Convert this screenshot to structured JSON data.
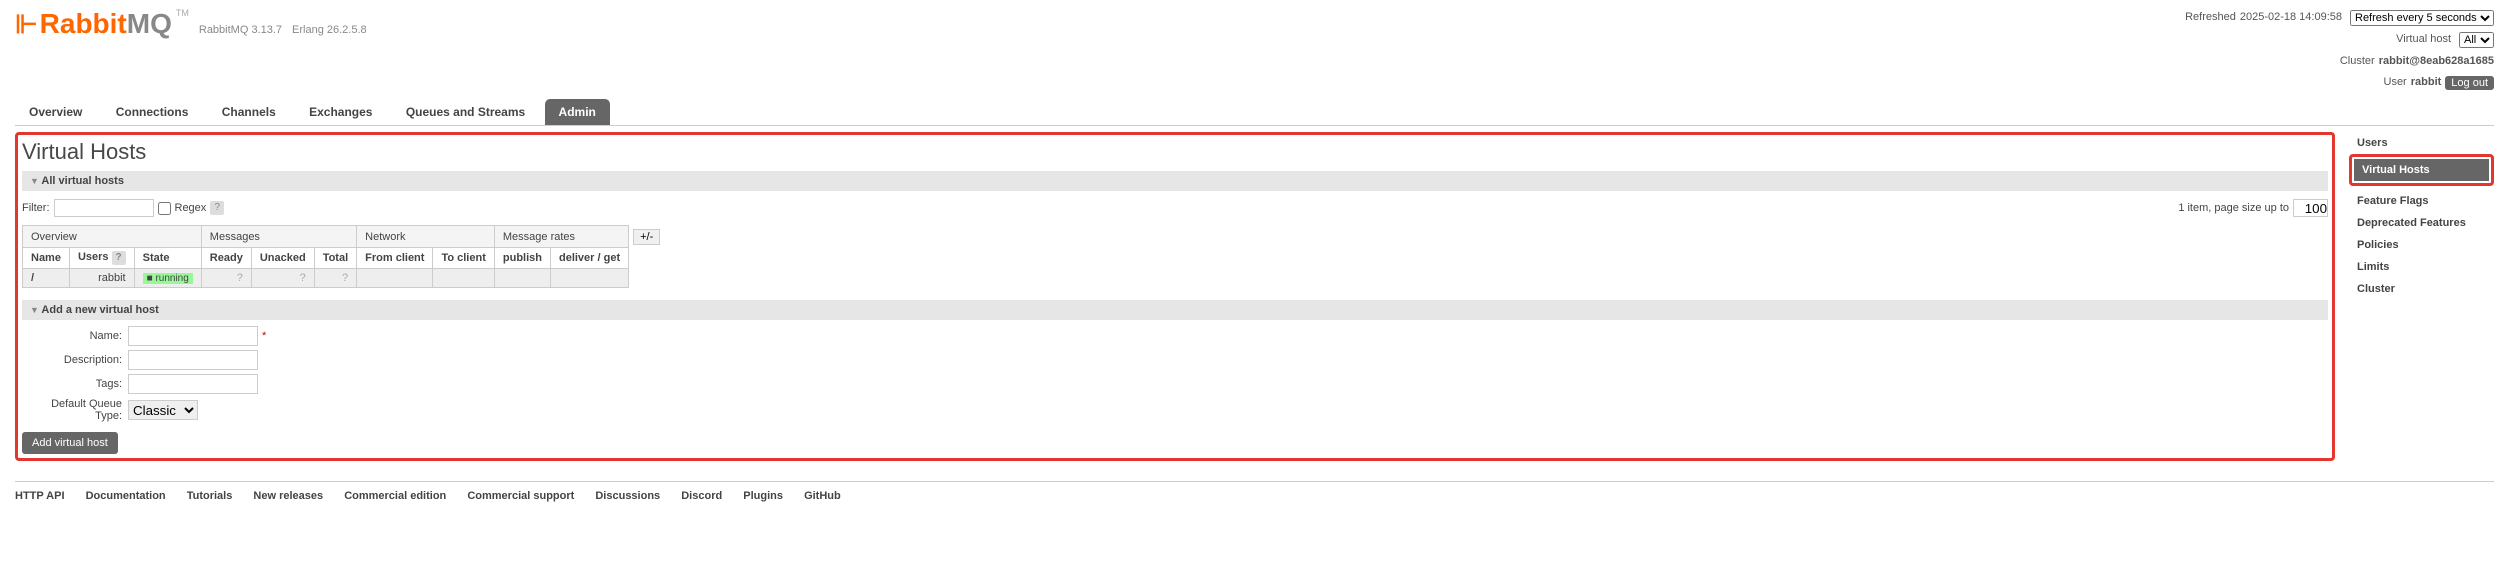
{
  "header": {
    "logo_rabbit": "Rabbit",
    "logo_mq": "MQ",
    "logo_tm": "TM",
    "version": "RabbitMQ 3.13.7",
    "erlang": "Erlang 26.2.5.8",
    "refreshed_label": "Refreshed",
    "refreshed_time": "2025-02-18 14:09:58",
    "refresh_select": "Refresh every 5 seconds",
    "vhost_label": "Virtual host",
    "vhost_select": "All",
    "cluster_label": "Cluster",
    "cluster_name": "rabbit@8eab628a1685",
    "user_label": "User",
    "user_name": "rabbit",
    "logout": "Log out"
  },
  "tabs": [
    {
      "label": "Overview"
    },
    {
      "label": "Connections"
    },
    {
      "label": "Channels"
    },
    {
      "label": "Exchanges"
    },
    {
      "label": "Queues and Streams"
    },
    {
      "label": "Admin",
      "selected": true
    }
  ],
  "sidebar": [
    {
      "label": "Users"
    },
    {
      "label": "Virtual Hosts",
      "selected": true
    },
    {
      "label": "Feature Flags"
    },
    {
      "label": "Deprecated Features"
    },
    {
      "label": "Policies"
    },
    {
      "label": "Limits"
    },
    {
      "label": "Cluster"
    }
  ],
  "page": {
    "title": "Virtual Hosts",
    "section1": "All virtual hosts",
    "section2": "Add a new virtual host",
    "filter_label": "Filter:",
    "regex_label": "Regex",
    "item_count": "1 item, page size up to",
    "page_size": "100",
    "pm": "+/-"
  },
  "table": {
    "groups": [
      "Overview",
      "Messages",
      "Network",
      "Message rates"
    ],
    "cols": [
      "Name",
      "Users",
      "State",
      "Ready",
      "Unacked",
      "Total",
      "From client",
      "To client",
      "publish",
      "deliver / get"
    ],
    "row": {
      "name": "/",
      "users": "rabbit",
      "state": "running",
      "ready": "?",
      "unacked": "?",
      "total": "?",
      "fromc": "",
      "toc": "",
      "pub": "",
      "del": ""
    }
  },
  "form": {
    "name_label": "Name:",
    "desc_label": "Description:",
    "tags_label": "Tags:",
    "dqt_label": "Default Queue Type:",
    "dqt_value": "Classic",
    "submit": "Add virtual host"
  },
  "footer": [
    "HTTP API",
    "Documentation",
    "Tutorials",
    "New releases",
    "Commercial edition",
    "Commercial support",
    "Discussions",
    "Discord",
    "Plugins",
    "GitHub"
  ]
}
